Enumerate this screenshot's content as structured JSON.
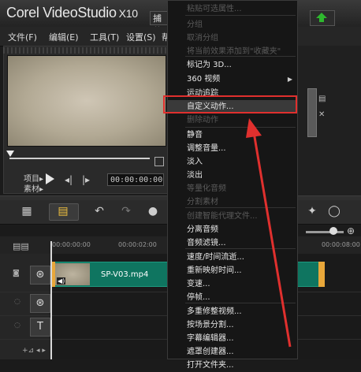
{
  "app": {
    "logo_main": "Corel VideoStudio",
    "logo_version": "X10",
    "capture_tab": "捕获"
  },
  "menubar": {
    "file": "文件(F)",
    "edit": "编辑(E)",
    "tools": "工具(T)",
    "settings": "设置(S)",
    "help": "帮"
  },
  "player": {
    "project_label": "项目▸",
    "clip_label": "素材▸",
    "timecode": "00:00:00:00"
  },
  "timeline": {
    "ruler_start": "00:00:00:00",
    "ruler_mid": "00:00:02:00",
    "ruler_end": "00:00:08:00",
    "clip_name": "SP-V03.mp4"
  },
  "context_menu": {
    "items": [
      {
        "label": "粘贴可选属性...",
        "disabled": true
      },
      {
        "label": "分组",
        "disabled": true
      },
      {
        "label": "取消分组",
        "disabled": true
      },
      {
        "label": "将当前效果添加到\"收藏夹\"",
        "disabled": true
      },
      {
        "label": "标记为 3D...",
        "disabled": false
      },
      {
        "label": "360 视频",
        "disabled": false,
        "submenu": true
      },
      {
        "label": "运动追踪",
        "disabled": false
      },
      {
        "label": "自定义动作...",
        "disabled": false,
        "highlighted": true
      },
      {
        "label": "删除动作",
        "disabled": true
      },
      {
        "label": "静音",
        "disabled": false
      },
      {
        "label": "调整音量...",
        "disabled": false
      },
      {
        "label": "淡入",
        "disabled": false
      },
      {
        "label": "淡出",
        "disabled": false
      },
      {
        "label": "等量化音频",
        "disabled": true
      },
      {
        "label": "分割素材",
        "disabled": true
      },
      {
        "label": "创建智能代理文件...",
        "disabled": true
      },
      {
        "label": "分离音频",
        "disabled": false
      },
      {
        "label": "音频滤镜...",
        "disabled": false
      },
      {
        "label": "速度/时间流逝...",
        "disabled": false
      },
      {
        "label": "重新映射时间...",
        "disabled": false
      },
      {
        "label": "变速...",
        "disabled": false
      },
      {
        "label": "停帧...",
        "disabled": false
      },
      {
        "label": "多重修整视频...",
        "disabled": false
      },
      {
        "label": "按场景分割...",
        "disabled": false
      },
      {
        "label": "字幕编辑器...",
        "disabled": false
      },
      {
        "label": "遮罩创建器...",
        "disabled": false
      },
      {
        "label": "打开文件夹...",
        "disabled": false
      }
    ]
  },
  "colors": {
    "highlight_box": "#e0302e",
    "clip_green": "#0f7560",
    "clip_edge": "#e8a73a"
  }
}
